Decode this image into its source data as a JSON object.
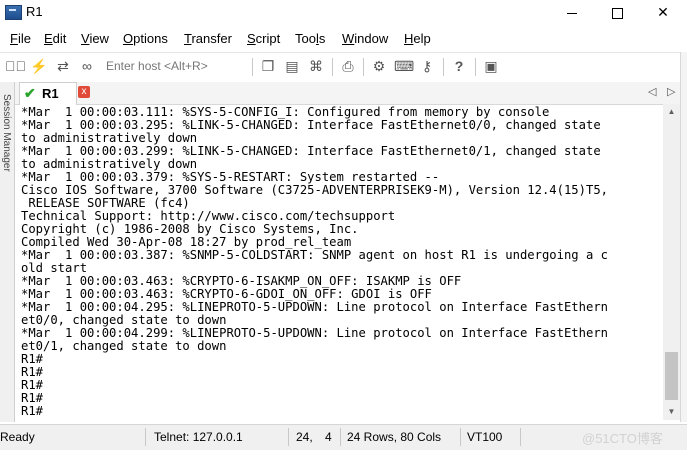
{
  "window": {
    "title": "R1"
  },
  "menu": [
    "File",
    "Edit",
    "View",
    "Options",
    "Transfer",
    "Script",
    "Tools",
    "Window",
    "Help"
  ],
  "menu_accel": [
    "F",
    "E",
    "V",
    "O",
    "T",
    "S",
    "l",
    "W",
    "H"
  ],
  "toolbar": {
    "host_placeholder": "Enter host <Alt+R>",
    "icons": [
      "map-icon",
      "lightning-icon",
      "reconnect-icon",
      "link-icon",
      "copy-icon",
      "paste-icon",
      "binoculars-icon",
      "print-icon",
      "gear-icon",
      "keyboard-icon",
      "key-icon",
      "help-icon",
      "image-icon"
    ]
  },
  "session_manager": {
    "label": "Session Manager"
  },
  "tab": {
    "label": "R1",
    "close": "x"
  },
  "terminal_lines": [
    "*Mar  1 00:00:03.111: %SYS-5-CONFIG_I: Configured from memory by console",
    "*Mar  1 00:00:03.295: %LINK-5-CHANGED: Interface FastEthernet0/0, changed state",
    "to administratively down",
    "*Mar  1 00:00:03.299: %LINK-5-CHANGED: Interface FastEthernet0/1, changed state",
    "to administratively down",
    "*Mar  1 00:00:03.379: %SYS-5-RESTART: System restarted --",
    "Cisco IOS Software, 3700 Software (C3725-ADVENTERPRISEK9-M), Version 12.4(15)T5,",
    " RELEASE SOFTWARE (fc4)",
    "Technical Support: http://www.cisco.com/techsupport",
    "Copyright (c) 1986-2008 by Cisco Systems, Inc.",
    "Compiled Wed 30-Apr-08 18:27 by prod_rel_team",
    "*Mar  1 00:00:03.387: %SNMP-5-COLDSTART: SNMP agent on host R1 is undergoing a c",
    "old start",
    "*Mar  1 00:00:03.463: %CRYPTO-6-ISAKMP_ON_OFF: ISAKMP is OFF",
    "*Mar  1 00:00:03.463: %CRYPTO-6-GDOI_ON_OFF: GDOI is OFF",
    "*Mar  1 00:00:04.295: %LINEPROTO-5-UPDOWN: Line protocol on Interface FastEthern",
    "et0/0, changed state to down",
    "*Mar  1 00:00:04.299: %LINEPROTO-5-UPDOWN: Line protocol on Interface FastEthern",
    "et0/1, changed state to down",
    "R1#",
    "R1#",
    "R1#",
    "R1#",
    "R1#"
  ],
  "status": {
    "ready": "Ready",
    "connection": "Telnet: 127.0.0.1",
    "row": "24,",
    "col": "4",
    "size": "24 Rows, 80 Cols",
    "term_type": "VT100",
    "watermark": "@51CTO博客"
  }
}
